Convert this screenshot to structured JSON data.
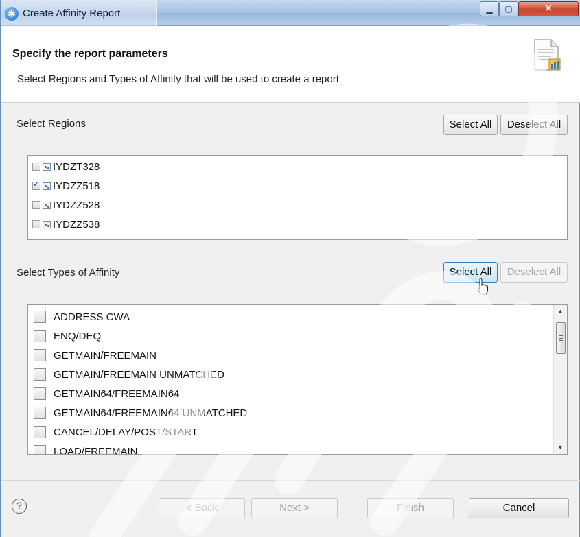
{
  "window": {
    "title": "Create Affinity Report",
    "app_icon": "asterisk-icon",
    "controls": {
      "minimize": "minimize-icon",
      "maximize": "maximize-icon",
      "close": "close-icon"
    }
  },
  "header": {
    "title": "Specify the report parameters",
    "subtitle": "Select Regions and Types of Affinity that will be used to create a report",
    "icon": "report-document-icon"
  },
  "regions": {
    "label": "Select Regions",
    "select_all": "Select All",
    "deselect_all": "Deselect All",
    "items": [
      {
        "label": "IYDZT328",
        "checked": false
      },
      {
        "label": "IYDZZ518",
        "checked": true
      },
      {
        "label": "IYDZZ528",
        "checked": false
      },
      {
        "label": "IYDZZ538",
        "checked": false
      }
    ]
  },
  "affinity": {
    "label": "Select Types of Affinity",
    "select_all": "Select All",
    "deselect_all": "Deselect All",
    "items": [
      "ADDRESS CWA",
      "ENQ/DEQ",
      "GETMAIN/FREEMAIN",
      "GETMAIN/FREEMAIN UNMATCHED",
      "GETMAIN64/FREEMAIN64",
      "GETMAIN64/FREEMAIN64 UNMATCHED",
      "CANCEL/DELAY/POST/START",
      "LOAD/FREEMAIN"
    ]
  },
  "footer": {
    "help": "?",
    "back": "< Back",
    "next": "Next >",
    "finish": "Finish",
    "cancel": "Cancel"
  },
  "colors": {
    "accent": "#3c7fb1",
    "titlebar": "#a9c3e3",
    "close": "#c9452f"
  }
}
